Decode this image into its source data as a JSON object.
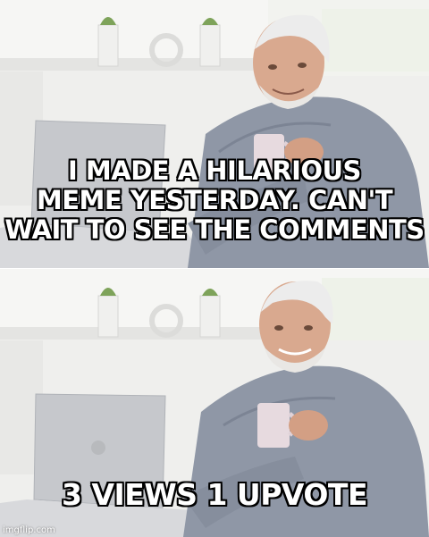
{
  "meme": {
    "top_caption": {
      "lines": [
        "I MADE A HILARIOUS",
        "MEME YESTERDAY. CAN'T",
        "WAIT TO SEE THE COMMENTS"
      ]
    },
    "bottom_caption": {
      "lines": [
        "3 VIEWS 1 UPVOTE"
      ]
    },
    "watermark": "imgflip.com"
  },
  "colors": {
    "background": "#ffffff",
    "wall": "#ececea",
    "shirt": "#8f97a6",
    "skin": "#d9a98f",
    "hair": "#ececec",
    "laptop": "#c9cbcf",
    "plant": "#7ea35a",
    "caption_text": "#ffffff",
    "caption_outline": "#000000"
  }
}
